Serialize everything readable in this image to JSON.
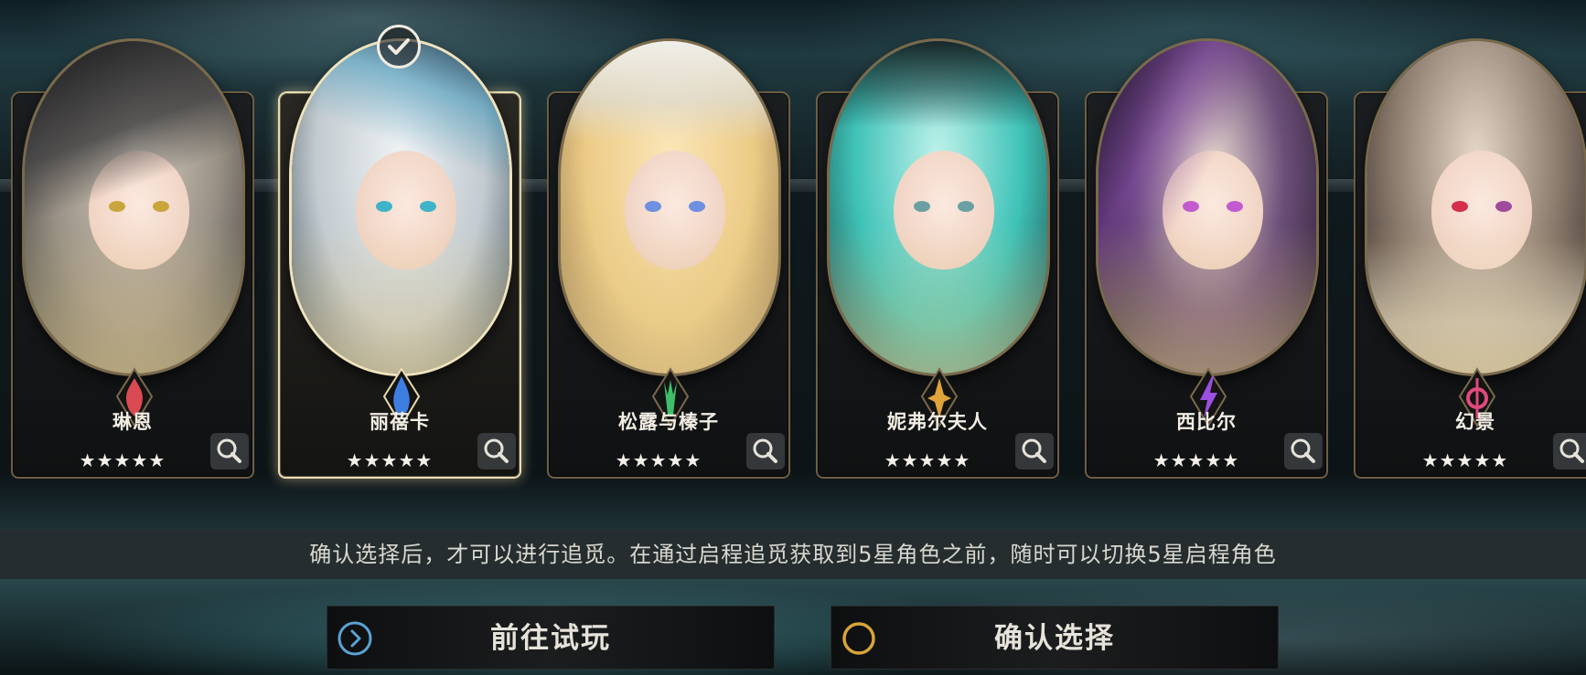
{
  "characters": [
    {
      "name": "琳恩",
      "stars": "★★★★★",
      "element_icon": "fire-element-icon",
      "element_color": "#d94a52",
      "hair_color": "#c9c2b4",
      "eye_color": "#c9a63c",
      "selected": false
    },
    {
      "name": "丽蓓卡",
      "stars": "★★★★★",
      "element_icon": "water-element-icon",
      "element_color": "#3d7ee0",
      "hair_color": "#d7dde2",
      "eye_color": "#3fb3c7",
      "selected": true
    },
    {
      "name": "松露与榛子",
      "stars": "★★★★★",
      "element_icon": "wood-element-icon",
      "element_color": "#3fbf6a",
      "hair_color": "#efcf8a",
      "eye_color": "#6f8fe0",
      "selected": false
    },
    {
      "name": "妮弗尔夫人",
      "stars": "★★★★★",
      "element_icon": "light-element-icon",
      "element_color": "#e0a33a",
      "hair_color": "#3ec2b7",
      "eye_color": "#6b9fa4",
      "selected": false
    },
    {
      "name": "西比尔",
      "stars": "★★★★★",
      "element_icon": "lightning-element-icon",
      "element_color": "#9b4fe0",
      "hair_color": "#3a2a44",
      "eye_color": "#c25bd0",
      "selected": false
    },
    {
      "name": "幻景",
      "stars": "★★★★★",
      "element_icon": "mirage-element-icon",
      "element_color": "#e04a7c",
      "hair_color": "#8a7a6c",
      "eye_color": "#a04c9c",
      "selected": false
    }
  ],
  "notice": "确认选择后，才可以进行追觅。在通过启程追觅获取到5星角色之前，随时可以切换5星启程角色",
  "buttons": {
    "trial": "前往试玩",
    "confirm": "确认选择"
  },
  "colors": {
    "frame_gold": "#6e5f45",
    "selected_frame": "#e9dcaf",
    "trial_icon": "#5aa3d6",
    "confirm_icon": "#d9a53a"
  }
}
